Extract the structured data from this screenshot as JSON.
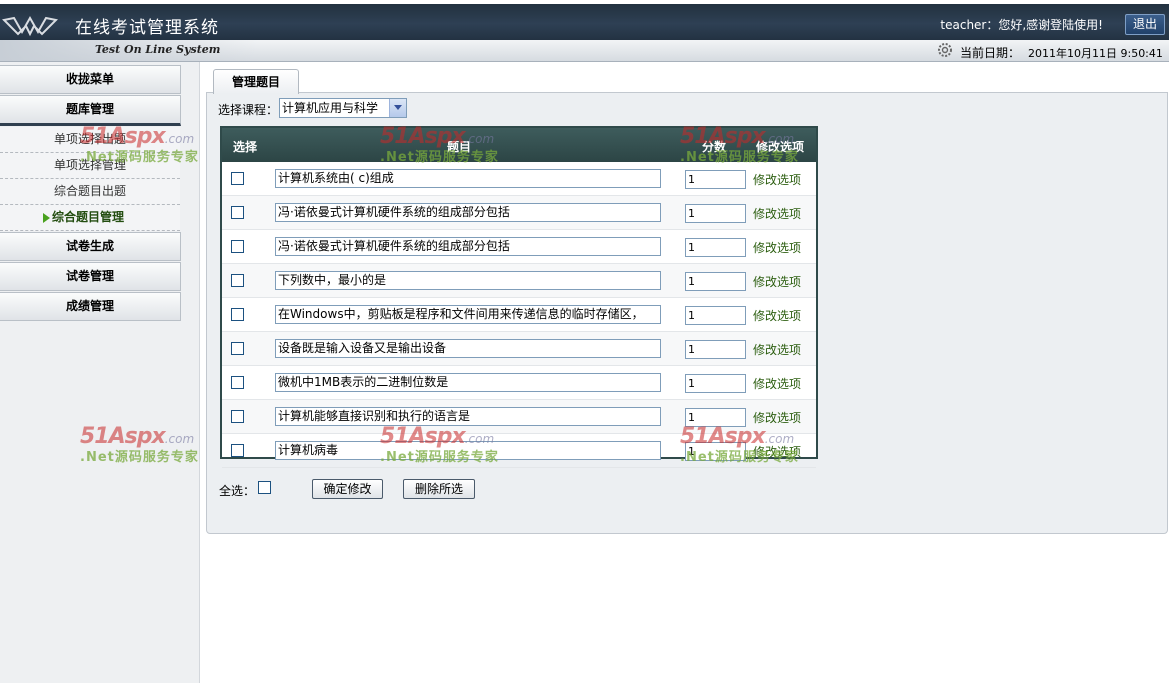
{
  "header": {
    "app_title": "在线考试管理系统",
    "subtitle": "Test On Line System",
    "welcome": "teacher：您好,感谢登陆使用!",
    "logout": "退出",
    "date_label": "当前日期：",
    "date_value": "2011年10月11日 9:50:41"
  },
  "sidebar": {
    "items": [
      {
        "label": "收拢菜单"
      },
      {
        "label": "题库管理"
      },
      {
        "label": "试卷生成"
      },
      {
        "label": "试卷管理"
      },
      {
        "label": "成绩管理"
      }
    ],
    "subitems": [
      {
        "label": "单项选择出题"
      },
      {
        "label": "单项选择管理"
      },
      {
        "label": "综合题目出题"
      },
      {
        "label": "综合题目管理"
      }
    ]
  },
  "main": {
    "tab": "管理题目",
    "course_label": "选择课程：",
    "course_value": "计算机应用与科学",
    "table": {
      "headers": [
        "选择",
        "题目",
        "分数",
        "修改选项"
      ],
      "rows": [
        {
          "question": "计算机系统由( c)组成",
          "score": "1",
          "action": "修改选项"
        },
        {
          "question": "冯·诺依曼式计算机硬件系统的组成部分包括",
          "score": "1",
          "action": "修改选项"
        },
        {
          "question": "冯·诺依曼式计算机硬件系统的组成部分包括",
          "score": "1",
          "action": "修改选项"
        },
        {
          "question": "下列数中，最小的是",
          "score": "1",
          "action": "修改选项"
        },
        {
          "question": "在Windows中，剪贴板是程序和文件间用来传递信息的临时存储区，",
          "score": "1",
          "action": "修改选项"
        },
        {
          "question": "设备既是输入设备又是输出设备",
          "score": "1",
          "action": "修改选项"
        },
        {
          "question": "微机中1MB表示的二进制位数是",
          "score": "1",
          "action": "修改选项"
        },
        {
          "question": "计算机能够直接识别和执行的语言是",
          "score": "1",
          "action": "修改选项"
        },
        {
          "question": "计算机病毒",
          "score": "1",
          "action": "修改选项"
        }
      ]
    },
    "select_all": "全选：",
    "confirm_button": "确定修改",
    "delete_button": "删除所选"
  },
  "watermark": {
    "logo": "51Aspx",
    "logo_suffix": ".com",
    "tagline": ".Net源码服务专家"
  }
}
